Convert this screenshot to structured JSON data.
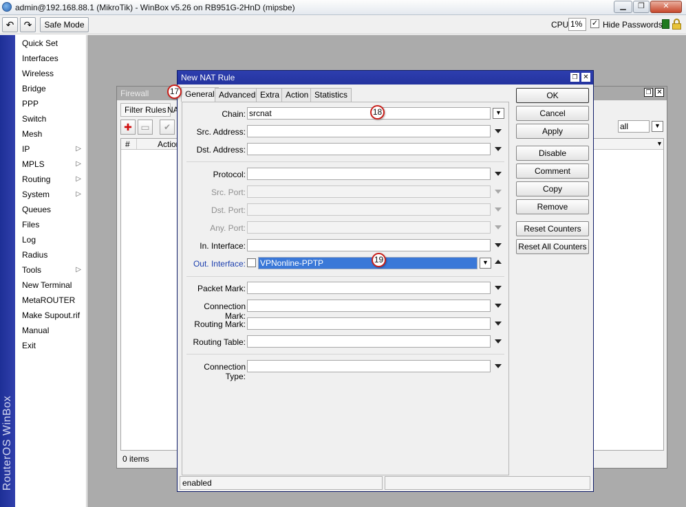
{
  "window": {
    "title": "admin@192.168.88.1 (MikroTik) - WinBox v5.26 on RB951G-2HnD (mipsbe)",
    "minimize_icon": "minimize-icon",
    "maximize_icon": "maximize-icon",
    "close_icon": "close-icon"
  },
  "toolbar": {
    "safe_mode": "Safe Mode",
    "cpu_label": "CPU:",
    "cpu_value": "1%",
    "hide_passwords": "Hide Passwords",
    "hide_passwords_checked": "✓"
  },
  "side_strip": {
    "text": "RouterOS WinBox"
  },
  "menu": {
    "items": [
      {
        "label": "Quick Set"
      },
      {
        "label": "Interfaces"
      },
      {
        "label": "Wireless"
      },
      {
        "label": "Bridge"
      },
      {
        "label": "PPP"
      },
      {
        "label": "Switch"
      },
      {
        "label": "Mesh"
      },
      {
        "label": "IP"
      },
      {
        "label": "MPLS"
      },
      {
        "label": "Routing"
      },
      {
        "label": "System"
      },
      {
        "label": "Queues"
      },
      {
        "label": "Files"
      },
      {
        "label": "Log"
      },
      {
        "label": "Radius"
      },
      {
        "label": "Tools"
      },
      {
        "label": "New Terminal"
      },
      {
        "label": "MetaROUTER"
      },
      {
        "label": "Make Supout.rif"
      },
      {
        "label": "Manual"
      },
      {
        "label": "Exit"
      }
    ]
  },
  "firewall": {
    "title": "Firewall",
    "tab_filter": "Filter Rules",
    "tab_nat": "NA",
    "col_hash": "#",
    "col_action": "Action",
    "items_count": "0 items",
    "filter_value": "all"
  },
  "nat": {
    "title": "New NAT Rule",
    "tabs": {
      "general": "General",
      "advanced": "Advanced",
      "extra": "Extra",
      "action": "Action",
      "statistics": "Statistics"
    },
    "fields": {
      "chain_label": "Chain:",
      "chain_value": "srcnat",
      "src_address_label": "Src. Address:",
      "dst_address_label": "Dst. Address:",
      "protocol_label": "Protocol:",
      "src_port_label": "Src. Port:",
      "dst_port_label": "Dst. Port:",
      "any_port_label": "Any. Port:",
      "in_interface_label": "In. Interface:",
      "out_interface_label": "Out. Interface:",
      "out_interface_value": "VPNonline-PPTP",
      "packet_mark_label": "Packet Mark:",
      "connection_mark_label": "Connection Mark:",
      "routing_mark_label": "Routing Mark:",
      "routing_table_label": "Routing Table:",
      "connection_type_label": "Connection Type:"
    },
    "buttons": {
      "ok": "OK",
      "cancel": "Cancel",
      "apply": "Apply",
      "disable": "Disable",
      "comment": "Comment",
      "copy": "Copy",
      "remove": "Remove",
      "reset_counters": "Reset Counters",
      "reset_all_counters": "Reset All Counters"
    },
    "status": "enabled"
  },
  "annotations": {
    "step_17": "17",
    "step_18": "18",
    "step_19": "19"
  }
}
